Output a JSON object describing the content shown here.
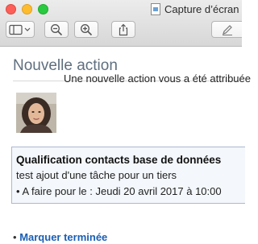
{
  "window": {
    "title": "Capture d’écran",
    "document_icon": "document-icon"
  },
  "toolbar": {
    "buttons": [
      {
        "name": "sidebar-toggle",
        "icon": "sidebar-icon"
      },
      {
        "name": "zoom-out",
        "icon": "zoom-out-icon"
      },
      {
        "name": "zoom-in",
        "icon": "zoom-in-icon"
      },
      {
        "name": "share",
        "icon": "share-icon"
      },
      {
        "name": "markup",
        "icon": "pen-icon"
      }
    ]
  },
  "email": {
    "heading": "Nouvelle action",
    "intro": "Une nouvelle action vous a été attribuée",
    "task": {
      "title": "Qualification contacts base de données",
      "description": "test ajout d'une tâche pour un tiers",
      "due": "• A faire pour le : Jeudi 20 avril 2017 à 10:00"
    },
    "action_bullet": "•",
    "action_link": "Marquer terminée",
    "colors": {
      "heading": "#5f6f7f",
      "link": "#1a5fb4",
      "task_border": "#aab9cf",
      "task_background": "#f4f7fb"
    }
  }
}
